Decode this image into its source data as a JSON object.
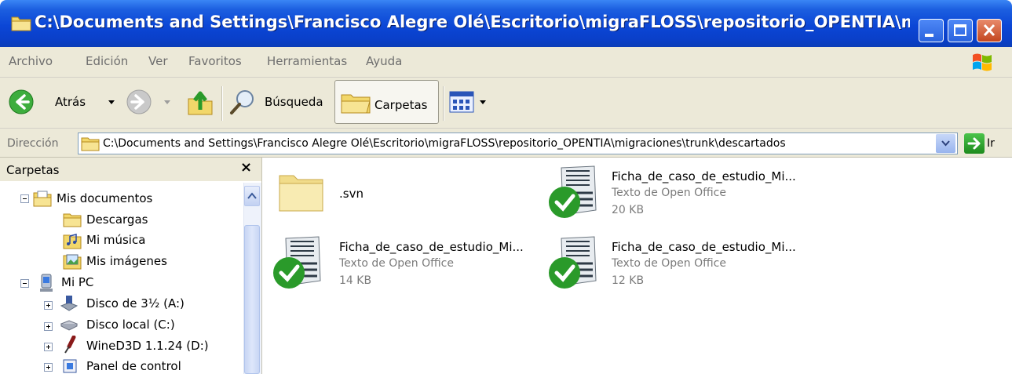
{
  "window": {
    "title": "C:\\Documents and Settings\\Francisco Alegre Olé\\Escritorio\\migraFLOSS\\repositorio_OPENTIA\\migrac"
  },
  "menu": [
    "Archivo",
    "Edición",
    "Ver",
    "Favoritos",
    "Herramientas",
    "Ayuda"
  ],
  "toolbar": {
    "back_label": "Atrás",
    "search_label": "Búsqueda",
    "folders_label": "Carpetas"
  },
  "address": {
    "label": "Dirección",
    "value": "C:\\Documents and Settings\\Francisco Alegre Olé\\Escritorio\\migraFLOSS\\repositorio_OPENTIA\\migraciones\\trunk\\descartados",
    "go_label": "Ir"
  },
  "folder_pane": {
    "title": "Carpetas",
    "close_label": "×",
    "items": [
      {
        "label": "Mis documentos"
      },
      {
        "label": "Descargas"
      },
      {
        "label": "Mi música"
      },
      {
        "label": "Mis imágenes"
      },
      {
        "label": "Mi PC"
      },
      {
        "label": "Disco de 3½ (A:)"
      },
      {
        "label": "Disco local (C:)"
      },
      {
        "label": "WineD3D 1.1.24 (D:)"
      },
      {
        "label": "Panel de control"
      }
    ]
  },
  "files": [
    {
      "name": ".svn",
      "type": "",
      "size": ""
    },
    {
      "name": "Ficha_de_caso_de_estudio_Mi...",
      "type": "Texto de Open Office",
      "size": "20 KB"
    },
    {
      "name": "Ficha_de_caso_de_estudio_Mi...",
      "type": "Texto de Open Office",
      "size": "14 KB"
    },
    {
      "name": "Ficha_de_caso_de_estudio_Mi...",
      "type": "Texto de Open Office",
      "size": "12 KB"
    }
  ]
}
